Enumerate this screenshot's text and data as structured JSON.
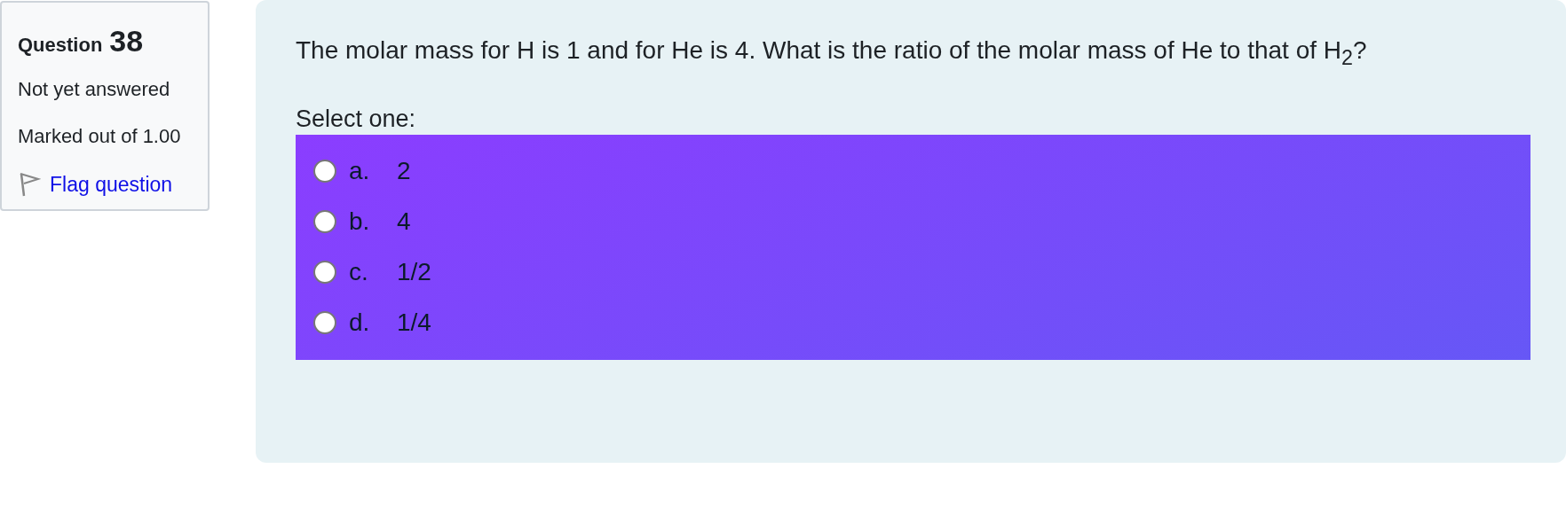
{
  "info": {
    "label": "Question",
    "number": "38",
    "status": "Not yet answered",
    "mark": "Marked out of 1.00",
    "flag": {
      "label": "Flag question",
      "flagged": false
    }
  },
  "question": {
    "text": "The molar mass for H is 1 and for He is 4. What is the ratio of the molar mass of He to that of H$_{2}$?",
    "prompt": "Select one:",
    "options": [
      {
        "letter": "a.",
        "text": "2",
        "selected": false
      },
      {
        "letter": "b.",
        "text": "4",
        "selected": false
      },
      {
        "letter": "c.",
        "text": "1/2",
        "selected": false
      },
      {
        "letter": "d.",
        "text": "1/4",
        "selected": false
      }
    ]
  }
}
